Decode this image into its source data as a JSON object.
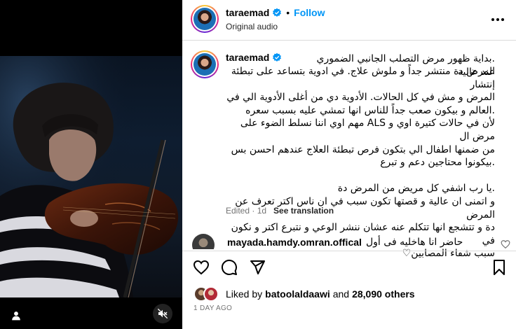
{
  "post": {
    "username": "taraemad",
    "follow_label": "Follow",
    "separator": "•",
    "audio": "Original audio",
    "caption_first_line": ".بداية ظهور مرض التصلب الجانبي الضموري عند عالية",
    "caption_rest": "المرض دة منتشر جداً و ملوش علاج. في ادوية بتساعد على تبطئة إنتشار\nالمرض و مش في كل الحالات. الأدوية دي من أغلى الأدوية الي في\n.العالم و بيكون صعب جداً للناس انها تمشي عليه بسبب سعره\nلأن في حالات كتيرة اوي و ALS مهم اوي اننا نسلط الضوء على مرض ال\nمن ضمنها اطفال الي بتكون فرص تبطئة العلاج عندهم احسن بس\n.بيكونوا محتاجين دعم و تبرع\n\n.يا رب اشفي كل مريض من المرض دة\nو اتمنى ان عالية و قصتها تكون سبب في ان ناس اكتر تعرف عن المرض\nدة و تتشجع انها تتكلم عنه عشان ننشر الوعي و نتبرع اكتر و نكون في\nسبب شفاء المصابين♡",
    "edited": "Edited · 1d",
    "see_translation": "See translation"
  },
  "comment": {
    "username": "mayada.hamdy.omran.offical",
    "text": "حاضر انا هاخليه فى أول"
  },
  "engagement": {
    "liked_by_prefix": "Liked by",
    "liked_by_user": "batoolaldaawi",
    "and": "and",
    "others_count": "28,090 others",
    "date": "1 DAY AGO"
  },
  "icons": {
    "verified": "verified-badge-icon",
    "more": "more-horizontal-icon",
    "like": "heart-icon",
    "comment": "comment-bubble-icon",
    "share": "paper-plane-icon",
    "save": "bookmark-icon",
    "user_tag": "person-tag-icon",
    "mute": "speaker-muted-icon"
  },
  "colors": {
    "accent": "#0095f6",
    "verified": "#0095f6",
    "muted_text": "#737373",
    "border": "#dbdbdb"
  }
}
